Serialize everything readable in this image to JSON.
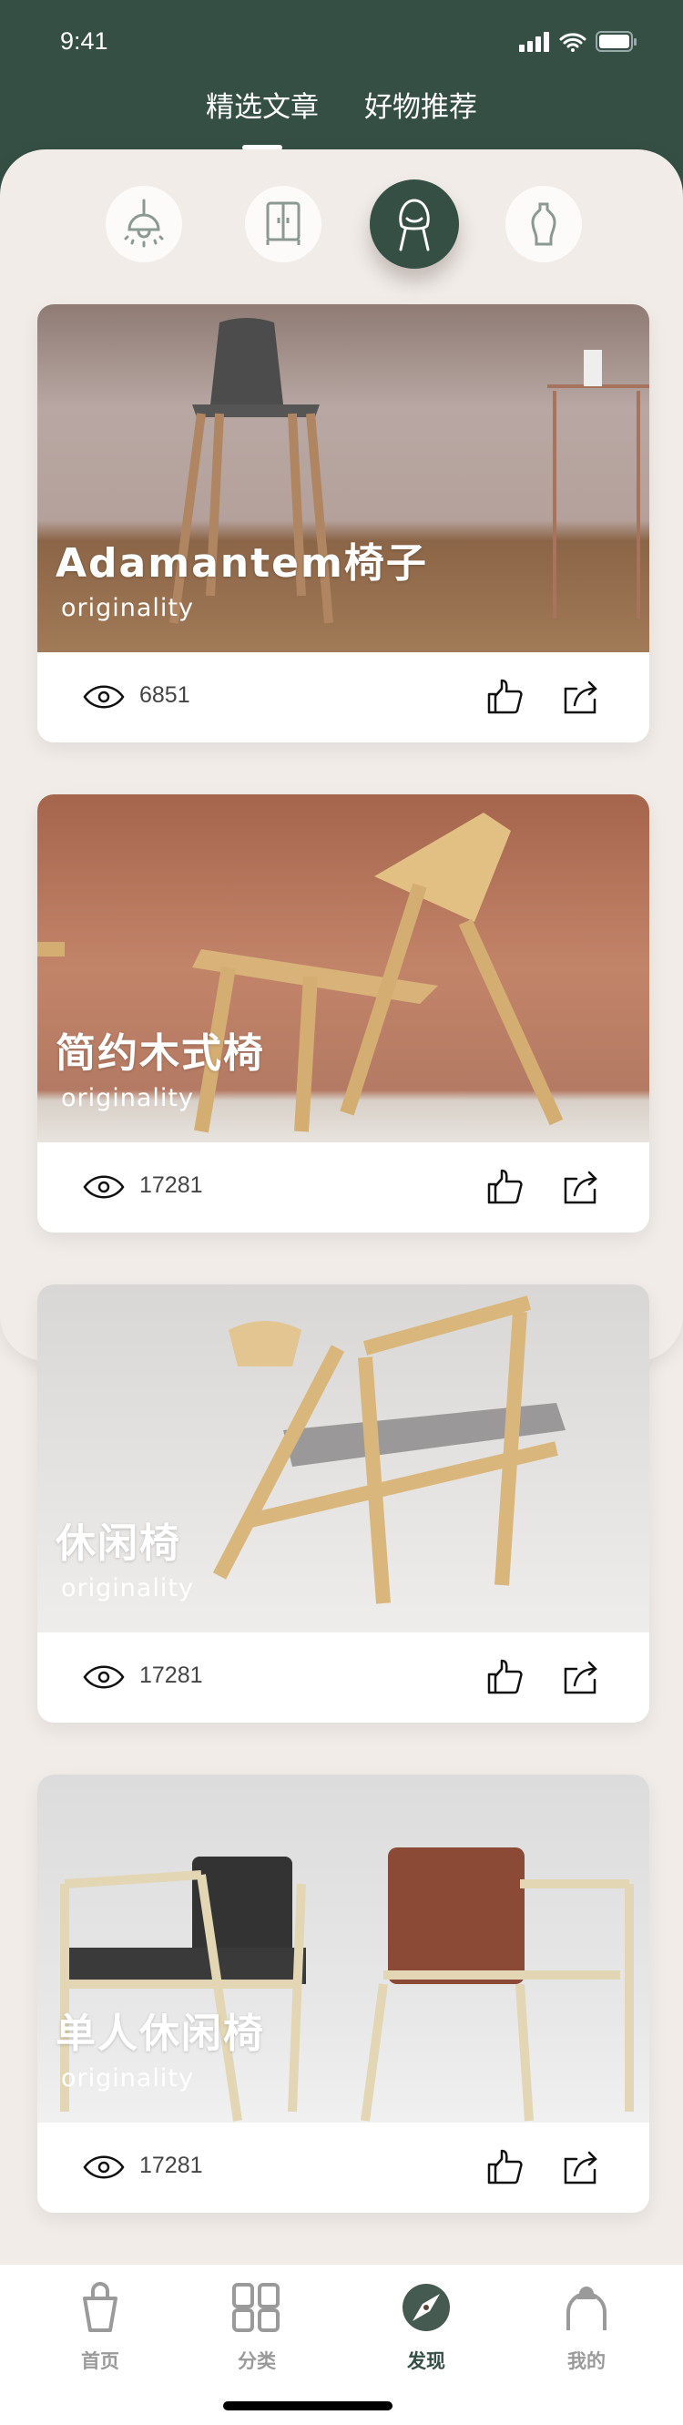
{
  "status": {
    "time": "9:41"
  },
  "tabs": [
    {
      "label": "精选文章",
      "active": true
    },
    {
      "label": "好物推荐",
      "active": false
    }
  ],
  "categories": [
    {
      "icon": "lamp-icon"
    },
    {
      "icon": "wardrobe-icon"
    },
    {
      "icon": "chair-icon",
      "active": true
    },
    {
      "icon": "vase-icon"
    }
  ],
  "cards": [
    {
      "title": "Adamantem椅子",
      "subtitle": "originality",
      "views": "6851"
    },
    {
      "title": "简约木式椅",
      "subtitle": "originality",
      "views": "17281"
    },
    {
      "title": "休闲椅",
      "subtitle": "originality",
      "views": "17281"
    },
    {
      "title": "单人休闲椅",
      "subtitle": "originality",
      "views": "17281"
    }
  ],
  "tabbar": [
    {
      "label": "首页"
    },
    {
      "label": "分类"
    },
    {
      "label": "发现",
      "active": true
    },
    {
      "label": "我的"
    }
  ],
  "colors": {
    "brand": "#354f45",
    "bg": "#f1ece8"
  }
}
